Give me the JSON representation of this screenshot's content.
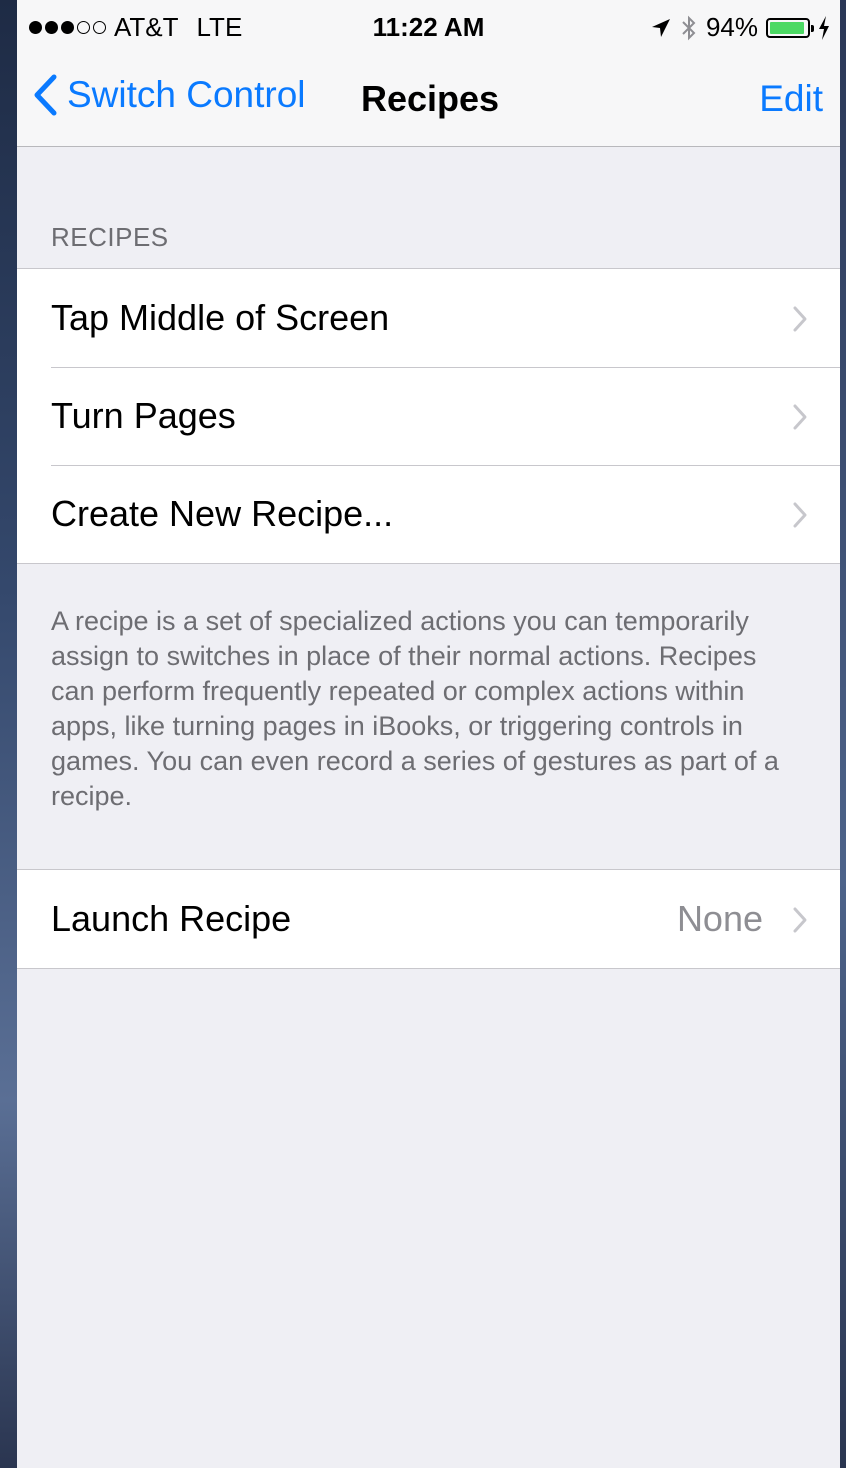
{
  "status_bar": {
    "signal_bars_filled": 3,
    "signal_bars_total": 5,
    "carrier": "AT&T",
    "network": "LTE",
    "time": "11:22 AM",
    "battery": "94%",
    "battery_level": 0.94,
    "icons": [
      "location-arrow-icon",
      "bluetooth-icon",
      "battery-icon",
      "charging-bolt-icon"
    ]
  },
  "nav": {
    "back_label": "Switch Control",
    "title": "Recipes",
    "edit_label": "Edit"
  },
  "section": {
    "header": "RECIPES",
    "items": [
      {
        "label": "Tap Middle of Screen"
      },
      {
        "label": "Turn Pages"
      },
      {
        "label": "Create New Recipe..."
      }
    ],
    "footer": "A recipe is a set of specialized actions you can temporarily assign to switches in place of their normal actions. Recipes can perform frequently repeated or complex actions within apps, like turning pages in iBooks, or triggering controls in games. You can even record a series of gestures as part of a recipe."
  },
  "launch": {
    "label": "Launch Recipe",
    "value": "None"
  },
  "colors": {
    "accent": "#0a7aff",
    "background": "#efeff4",
    "battery": "#4cd964",
    "secondary_text": "#6d6d72"
  }
}
